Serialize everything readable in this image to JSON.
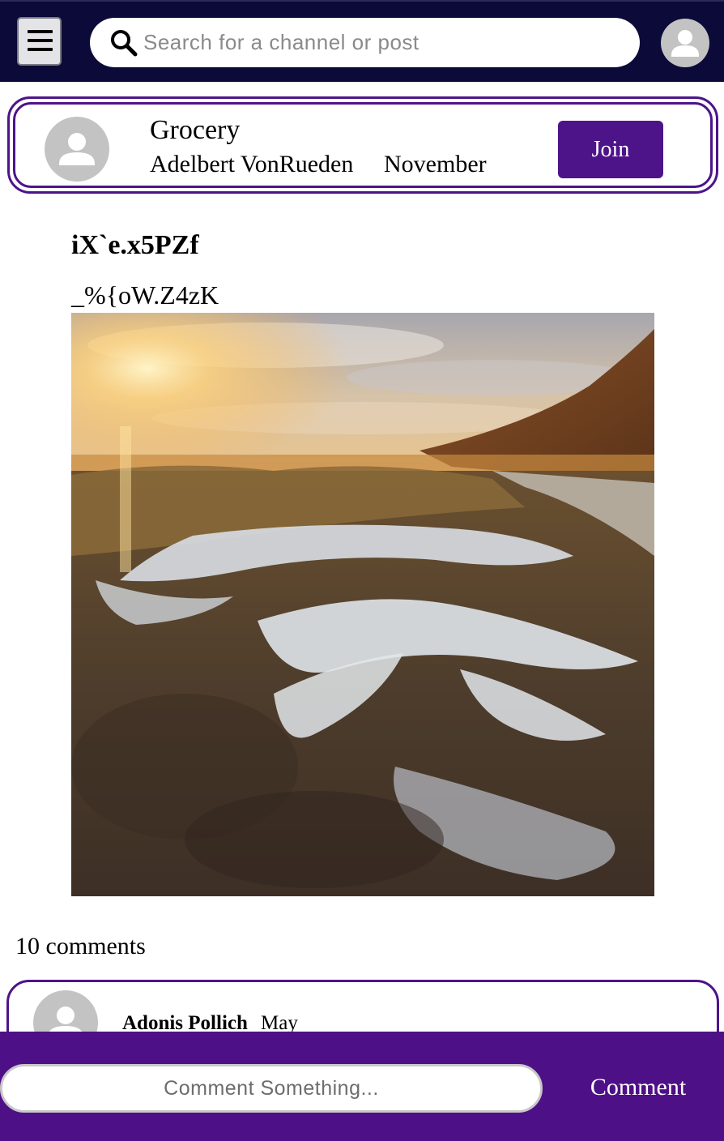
{
  "header": {
    "menu_icon": "hamburger-menu-icon",
    "search": {
      "icon": "search-icon",
      "placeholder": "Search for a channel or post",
      "value": ""
    },
    "profile_icon": "user-avatar-icon"
  },
  "channel": {
    "name": "Grocery",
    "owner": "Adelbert VonRueden",
    "date": "November",
    "join_label": "Join",
    "avatar_icon": "user-avatar-icon"
  },
  "post": {
    "title": "iX`e.x5PZf",
    "body": "_%{oW.Z4zK"
  },
  "comments": {
    "count_label": "10 comments",
    "items": [
      {
        "author": "Adonis Pollich",
        "date": "May",
        "avatar_icon": "user-avatar-icon"
      }
    ]
  },
  "composer": {
    "placeholder": "Comment Something...",
    "value": "",
    "submit_label": "Comment"
  },
  "colors": {
    "header_bg": "#0b0a38",
    "accent_purple": "#4d148a",
    "avatar_gray": "#c3c3c3"
  }
}
